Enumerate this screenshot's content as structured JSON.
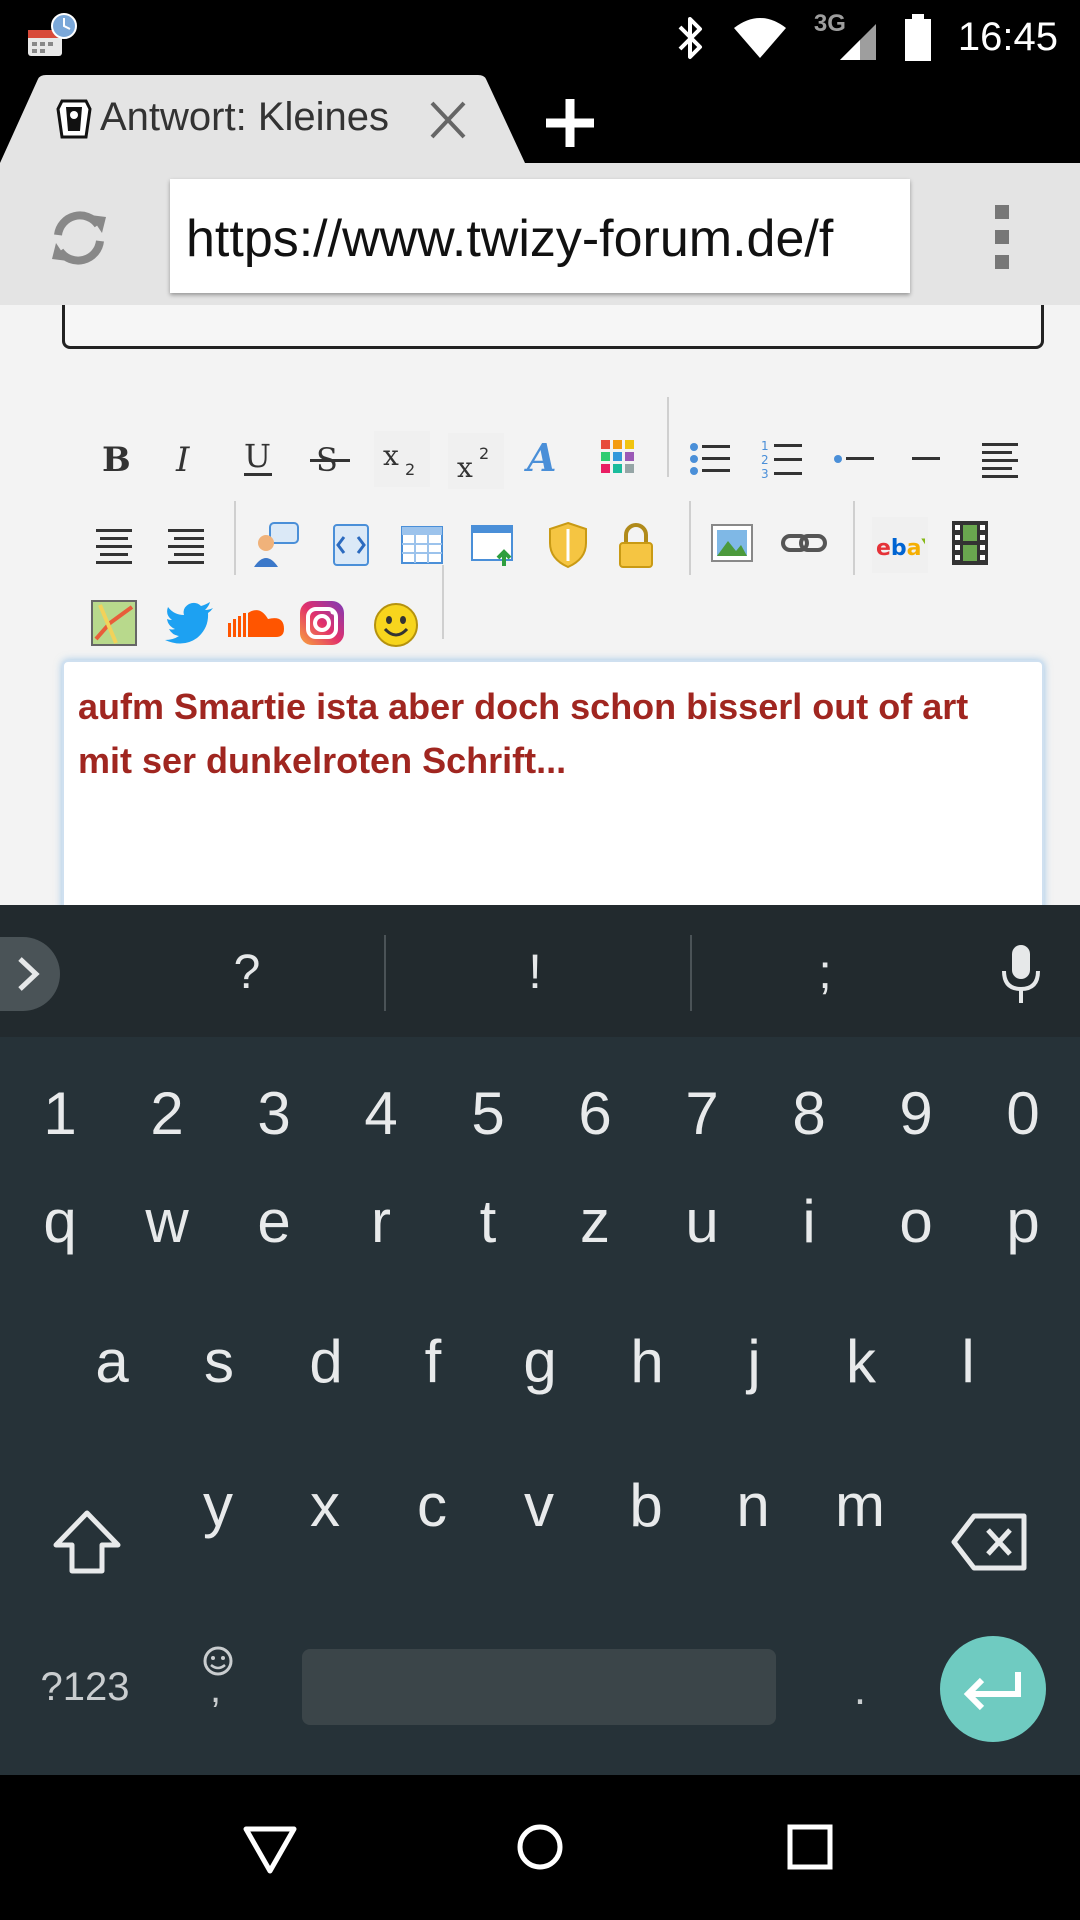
{
  "status_bar": {
    "time": "16:45",
    "network_label": "3G",
    "icons": [
      "notification-icon",
      "bluetooth-icon",
      "wifi-icon",
      "cell-signal-icon",
      "battery-icon"
    ]
  },
  "browser": {
    "tab_title": "Antwort: Kleines",
    "url": "https://www.twizy-forum.de/f"
  },
  "editor": {
    "text": "aufm Smartie ista aber doch schon bisserl out of art mit ser dunkelroten Schrift...",
    "text_color": "#a02620"
  },
  "keyboard": {
    "suggestions": [
      "?",
      "!",
      ";"
    ],
    "number_row": [
      "1",
      "2",
      "3",
      "4",
      "5",
      "6",
      "7",
      "8",
      "9",
      "0"
    ],
    "row1": [
      "q",
      "w",
      "e",
      "r",
      "t",
      "z",
      "u",
      "i",
      "o",
      "p"
    ],
    "row2": [
      "a",
      "s",
      "d",
      "f",
      "g",
      "h",
      "j",
      "k",
      "l"
    ],
    "row3": [
      "y",
      "x",
      "c",
      "v",
      "b",
      "n",
      "m"
    ],
    "symbols_key": "?123",
    "comma_key": ",",
    "period_key": ".",
    "accent_color": "#6fcbc1"
  }
}
